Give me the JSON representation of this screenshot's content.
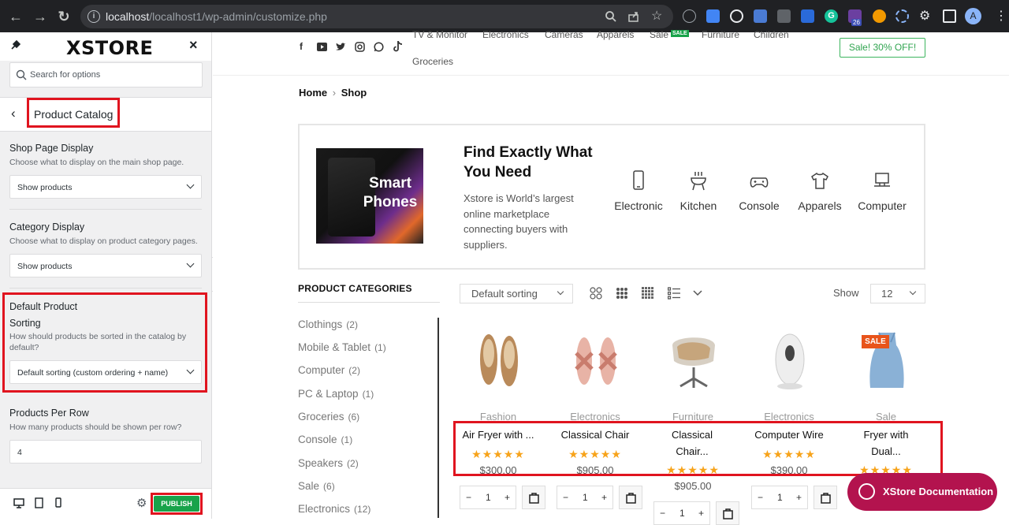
{
  "browser": {
    "url_host": "localhost",
    "url_path": "/localhost1/wp-admin/customize.php",
    "badge_count": "26",
    "profile_initial": "A"
  },
  "sidebar": {
    "logo": "XSTORE",
    "search_placeholder": "Search for options",
    "section_title": "Product Catalog",
    "shop_display": {
      "title": "Shop Page Display",
      "desc": "Choose what to display on the main shop page.",
      "value": "Show products"
    },
    "category_display": {
      "title": "Category Display",
      "desc": "Choose what to display on product category pages.",
      "value": "Show products"
    },
    "default_sorting": {
      "title_line1": "Default Product",
      "title_line2": "Sorting",
      "desc": "How should products be sorted in the catalog by default?",
      "value": "Default sorting (custom ordering + name)"
    },
    "per_row": {
      "title": "Products Per Row",
      "desc": "How many products should be shown per row?",
      "value": "4"
    },
    "publish_label": "PUBLISH"
  },
  "site": {
    "menu": [
      "TV & Monitor",
      "Electronics",
      "Cameras",
      "Apparels",
      "Sale",
      "Furniture",
      "Children",
      "Groceries"
    ],
    "sale_tag": "SALE",
    "sale_pill": "Sale! 30% OFF!",
    "breadcrumb_home": "Home",
    "breadcrumb_current": "Shop",
    "hero": {
      "image_text_1": "Smart",
      "image_text_2": "Phones",
      "title": "Find Exactly What You Need",
      "text": "Xstore is World’s largest online marketplace connecting buyers with suppliers.",
      "categories": [
        "Electronic",
        "Kitchen",
        "Console",
        "Apparels",
        "Computer"
      ]
    },
    "product_categories_title": "PRODUCT CATEGORIES",
    "categories": [
      {
        "name": "Clothings",
        "count": "(2)"
      },
      {
        "name": "Mobile & Tablet",
        "count": "(1)"
      },
      {
        "name": "Computer",
        "count": "(2)"
      },
      {
        "name": "PC & Laptop",
        "count": "(1)"
      },
      {
        "name": "Groceries",
        "count": "(6)"
      },
      {
        "name": "Console",
        "count": "(1)"
      },
      {
        "name": "Speakers",
        "count": "(2)"
      },
      {
        "name": "Sale",
        "count": "(6)"
      },
      {
        "name": "Electronics",
        "count": "(12)"
      }
    ],
    "sorting_value": "Default sorting",
    "show_label": "Show",
    "show_value": "12",
    "products": [
      {
        "category": "Fashion",
        "name": "Air Fryer with ...",
        "price": "$300.00",
        "stars": "★★★★★"
      },
      {
        "category": "Electronics",
        "name": "Classical Chair",
        "price": "$905.00",
        "stars": "★★★★★"
      },
      {
        "category": "Furniture",
        "name": "Classical Chair...",
        "price": "$905.00",
        "stars": "★★★★★"
      },
      {
        "category": "Electronics",
        "name": "Computer Wire",
        "price": "$390.00",
        "stars": "★★★★★"
      },
      {
        "category": "Sale",
        "name": "Fryer with Dual...",
        "price": "",
        "stars": "★★★★★"
      }
    ],
    "sale_badge": "SALE",
    "qty_value": "1",
    "doc_button": "XStore Documentation"
  },
  "colors": {
    "highlight_red": "#e0141f",
    "publish_green": "#18a34a",
    "star_orange": "#f7a31a",
    "doc_button": "#b3134e",
    "sale_badge": "#e8541b"
  }
}
